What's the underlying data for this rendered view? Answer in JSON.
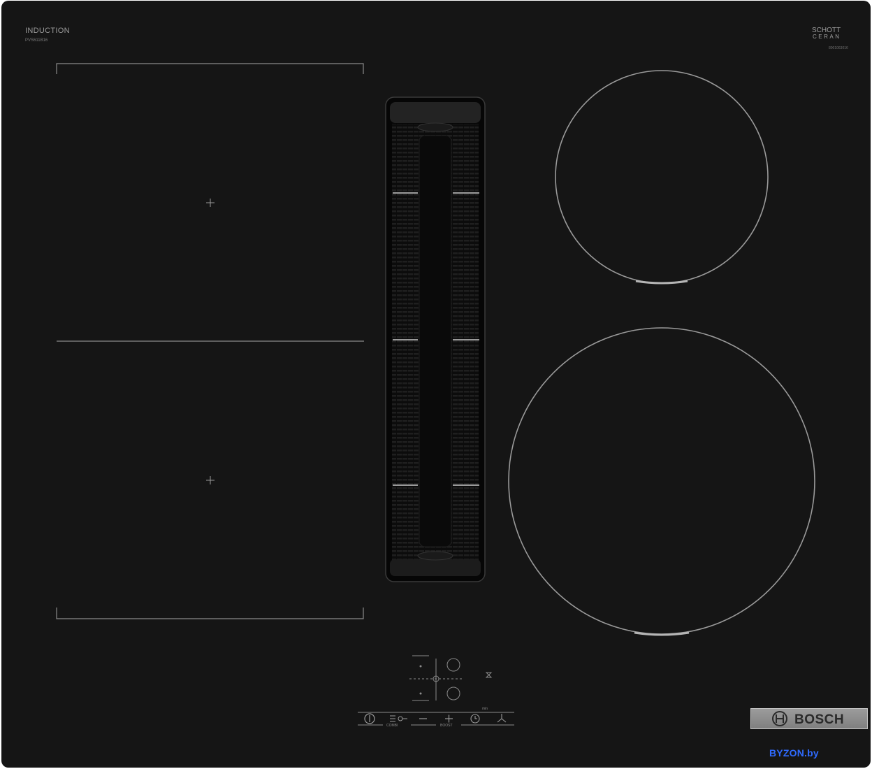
{
  "cooktop": {
    "type_label": "INDUCTION",
    "model": "PVS611B16",
    "glass_brand_line1": "SCHOTT",
    "glass_brand_line2": "CERAN",
    "serial": "8001063016",
    "brand": "BOSCH",
    "watermark": "BYZON.by"
  },
  "controls": {
    "combi_label": "COMBI",
    "boost_label": "BOOST",
    "min_label": "min",
    "power_icon": "power-icon",
    "combi_icon": "combi-key-icon",
    "minus_icon": "minus-icon",
    "plus_icon": "plus-icon",
    "timer_icon": "clock-icon",
    "fan_icon": "fan-icon",
    "hourglass_icon": "hourglass-icon"
  },
  "colors": {
    "glass": "#151515",
    "zone_lines": "#8a8a8a",
    "bosch_badge": "#8e8e8e",
    "watermark": "#2f6bff"
  }
}
